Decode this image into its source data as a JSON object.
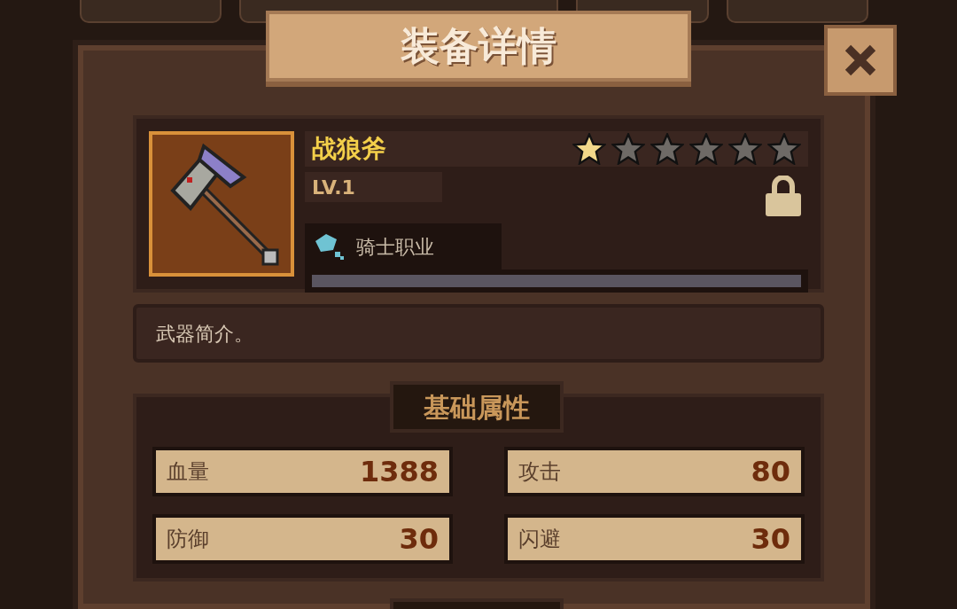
{
  "window": {
    "title": "装备详情"
  },
  "item": {
    "name": "战狼斧",
    "stars": 1,
    "level": "LV.1",
    "class_label": "骑士职业",
    "locked": true,
    "progress": {
      "level": 0
    }
  },
  "description": "武器简介。",
  "base_stats": {
    "title": "基础属性",
    "rows": [
      {
        "label": "血量",
        "value": "1388"
      },
      {
        "label": "攻击",
        "value": "80"
      },
      {
        "label": "防御",
        "value": "30"
      },
      {
        "label": "闪避",
        "value": "30"
      }
    ]
  }
}
